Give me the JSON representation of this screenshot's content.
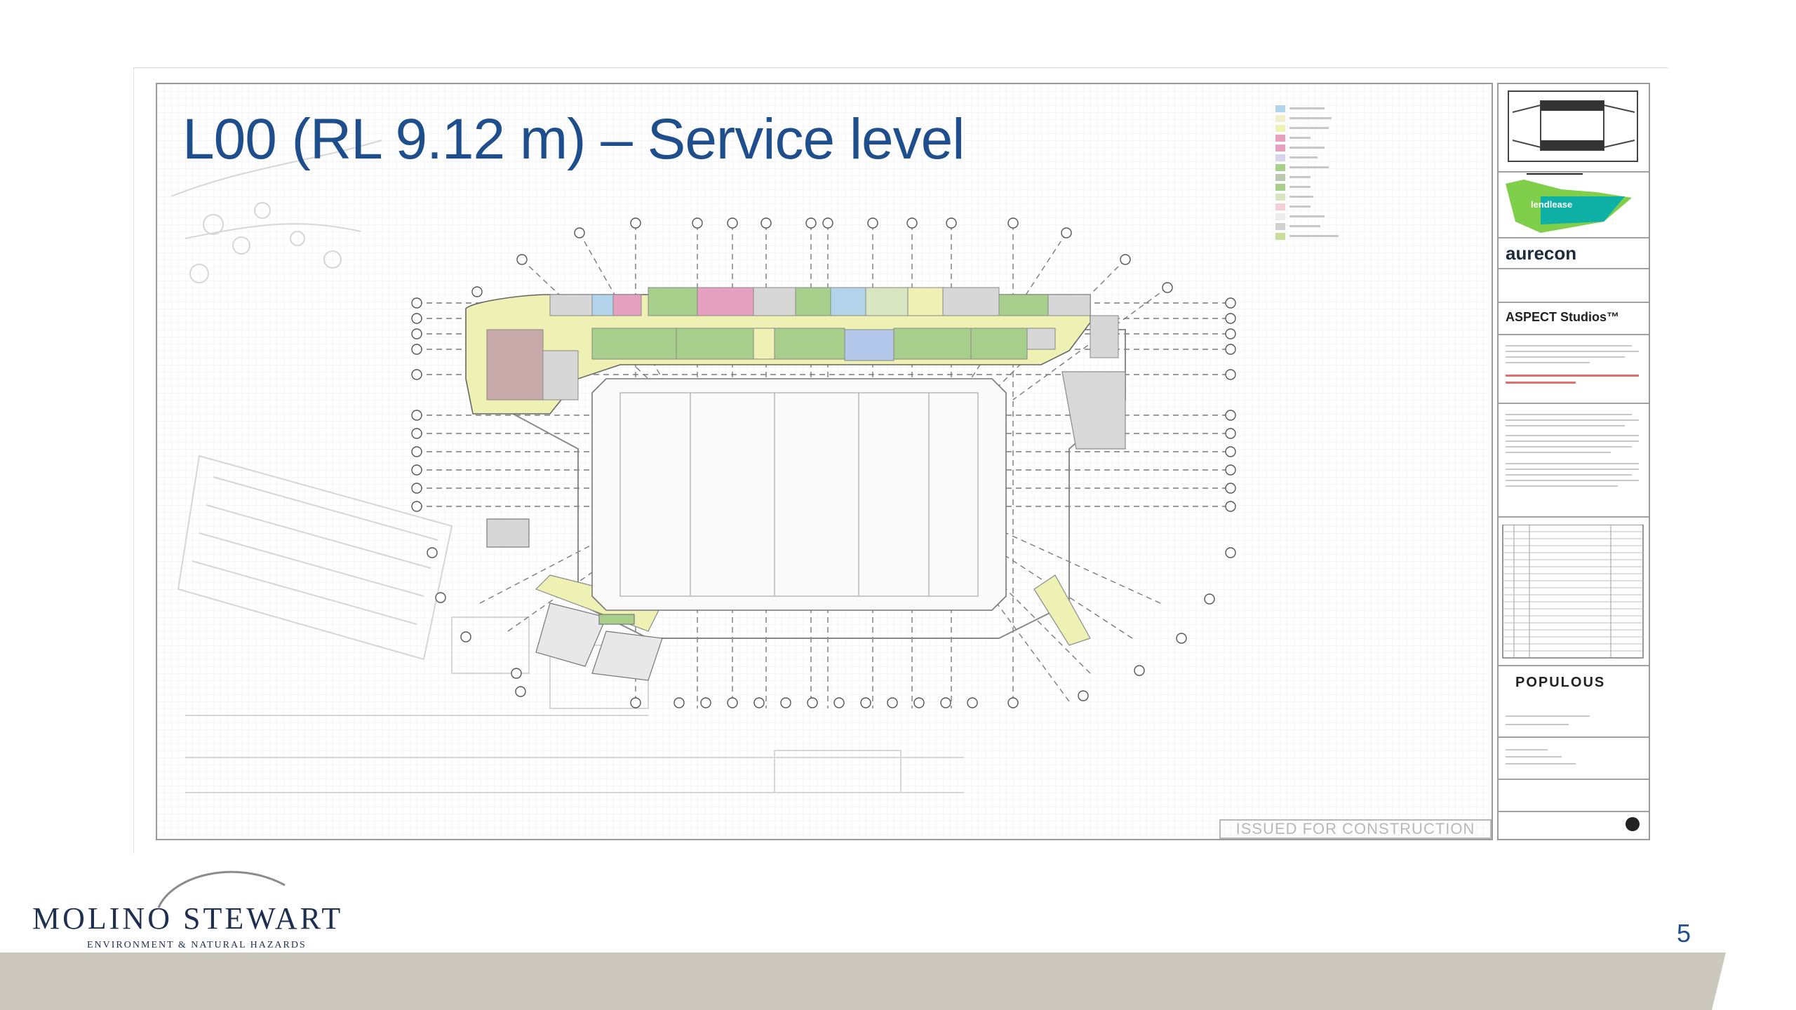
{
  "slide": {
    "title": "L00 (RL 9.12 m) – Service level",
    "page_number": "5"
  },
  "drawing": {
    "stamp": "ISSUED FOR CONSTRUCTION",
    "title_block": {
      "lendlease": "lendlease",
      "aurecon": "aurecon",
      "aspect": "ASPECT Studios™",
      "populous": "POPULOUS"
    }
  },
  "branding": {
    "logo_main": "MOLINO STEWART",
    "logo_sub": "ENVIRONMENT & NATURAL HAZARDS"
  },
  "colors": {
    "title_blue": "#1f4e8c",
    "footer_band": "#cdc8bd",
    "plan_green": "#a9cf8d",
    "plan_yellow": "#eef0b4",
    "plan_pink": "#e6a1c1",
    "plan_blue": "#b3d3ea",
    "plan_grey": "#b9b9b9"
  }
}
